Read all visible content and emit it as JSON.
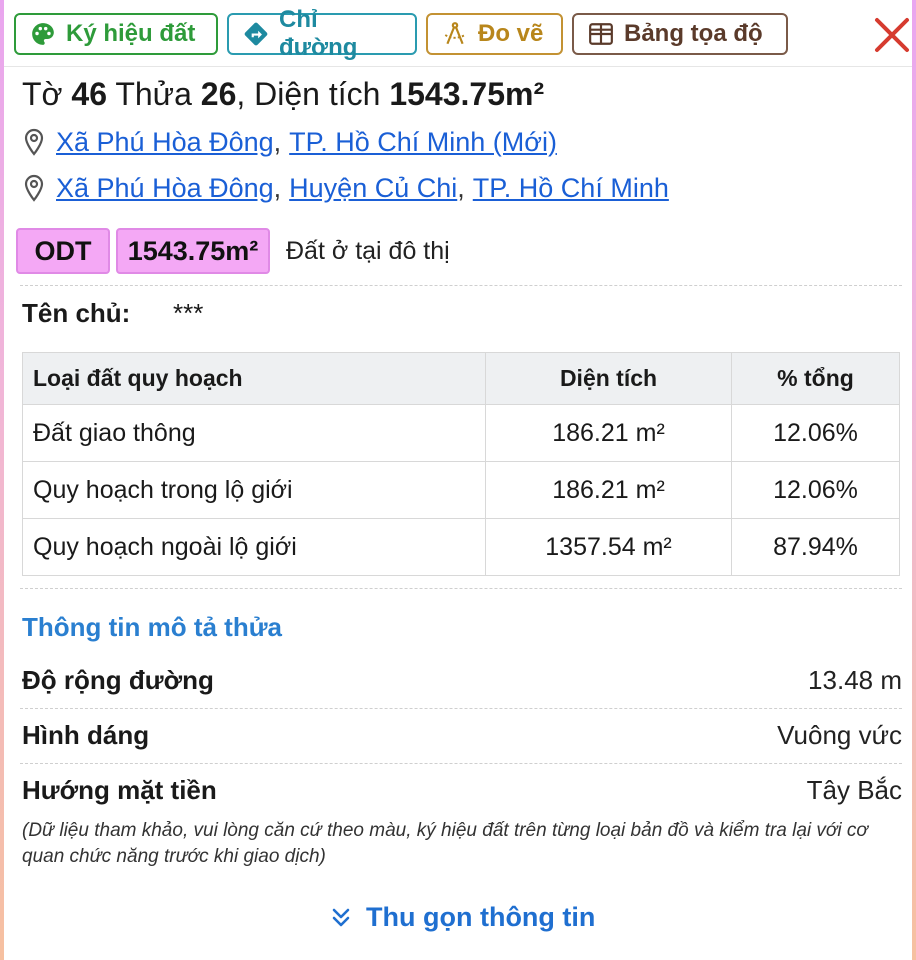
{
  "toolbar": {
    "legend_label": "Ký hiệu đất",
    "directions_label": "Chỉ đường",
    "measure_label": "Đo vẽ",
    "coords_label": "Bảng tọa độ"
  },
  "parcel": {
    "sheet_label": "Tờ",
    "sheet_no": "46",
    "plot_label": "Thửa",
    "plot_no": "26",
    "area_label": "Diện tích",
    "area_value": "1543.75m²"
  },
  "address_new": {
    "commune": "Xã Phú Hòa Đông",
    "city": "TP. Hồ Chí Minh (Mới)"
  },
  "address_old": {
    "commune": "Xã Phú Hòa Đông",
    "district": "Huyện Củ Chi",
    "city": "TP. Hồ Chí Minh"
  },
  "land_type": {
    "code": "ODT",
    "area": "1543.75m²",
    "description": "Đất ở tại đô thị",
    "color": "#f4a8f5"
  },
  "owner": {
    "label": "Tên chủ:",
    "value": "***"
  },
  "planning_table": {
    "headers": [
      "Loại đất quy hoạch",
      "Diện tích",
      "% tổng"
    ],
    "rows": [
      [
        "Đất giao thông",
        "186.21 m²",
        "12.06%"
      ],
      [
        "Quy hoạch trong lộ giới",
        "186.21 m²",
        "12.06%"
      ],
      [
        "Quy hoạch ngoài lộ giới",
        "1357.54 m²",
        "87.94%"
      ]
    ]
  },
  "description": {
    "title": "Thông tin mô tả thửa",
    "rows": [
      {
        "key": "Độ rộng đường",
        "value": "13.48 m"
      },
      {
        "key": "Hình dáng",
        "value": "Vuông vức"
      },
      {
        "key": "Hướng mặt tiền",
        "value": "Tây Bắc"
      }
    ],
    "note": "(Dữ liệu tham khảo, vui lòng căn cứ theo màu, ký hiệu đất trên từng loại bản đồ và kiểm tra lại với cơ quan chức năng trước khi giao dịch)"
  },
  "collapse_label": "Thu gọn thông tin",
  "colors": {
    "green": "#2e9b3a",
    "teal": "#1e8aa0",
    "gold": "#b8861b",
    "brown": "#5a3a2a",
    "close_red": "#d63b2f",
    "link_blue": "#1a5fd6",
    "section_blue": "#2a7fd0"
  }
}
